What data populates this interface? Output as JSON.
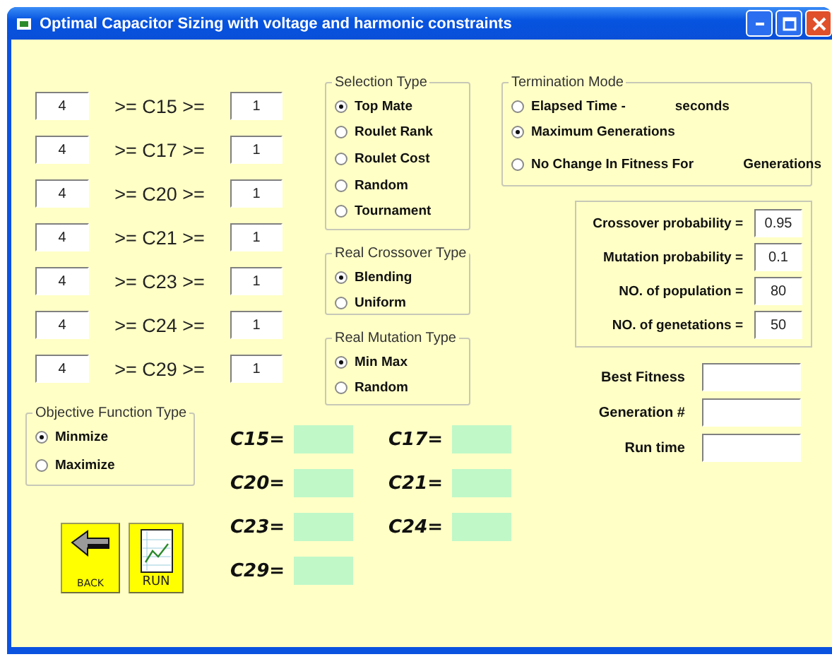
{
  "window": {
    "title": "Optimal Capacitor Sizing with voltage and harmonic constraints"
  },
  "range_rows": [
    {
      "upper": "4",
      "label": ">= C15 >=",
      "lower": "1"
    },
    {
      "upper": "4",
      "label": ">= C17 >=",
      "lower": "1"
    },
    {
      "upper": "4",
      "label": ">= C20 >=",
      "lower": "1"
    },
    {
      "upper": "4",
      "label": ">= C21 >=",
      "lower": "1"
    },
    {
      "upper": "4",
      "label": ">= C23 >=",
      "lower": "1"
    },
    {
      "upper": "4",
      "label": ">= C24 >=",
      "lower": "1"
    },
    {
      "upper": "4",
      "label": ">= C29 >=",
      "lower": "1"
    }
  ],
  "selection_type": {
    "title": "Selection Type",
    "options": [
      {
        "label": "Top Mate",
        "selected": true
      },
      {
        "label": "Roulet Rank",
        "selected": false
      },
      {
        "label": "Roulet Cost",
        "selected": false
      },
      {
        "label": "Random",
        "selected": false
      },
      {
        "label": "Tournament",
        "selected": false
      }
    ]
  },
  "crossover_type": {
    "title": "Real Crossover Type",
    "options": [
      {
        "label": "Blending",
        "selected": true
      },
      {
        "label": "Uniform",
        "selected": false
      }
    ]
  },
  "mutation_type": {
    "title": "Real Mutation Type",
    "options": [
      {
        "label": "Min Max",
        "selected": true
      },
      {
        "label": "Random",
        "selected": false
      }
    ]
  },
  "termination_mode": {
    "title": "Termination Mode",
    "options": [
      {
        "label": "Elapsed Time -",
        "suffix": "seconds",
        "selected": false
      },
      {
        "label": "Maximum Generations",
        "selected": true
      },
      {
        "label": "No Change In Fitness For",
        "suffix": "Generations",
        "selected": false
      }
    ]
  },
  "parameters": [
    {
      "label": "Crossover probability =",
      "value": "0.95"
    },
    {
      "label": "Mutation probability =",
      "value": "0.1"
    },
    {
      "label": "NO. of population =",
      "value": "80"
    },
    {
      "label": "NO. of genetations =",
      "value": "50"
    }
  ],
  "outputs": [
    {
      "label": "Best Fitness"
    },
    {
      "label": "Generation #"
    },
    {
      "label": "Run time"
    }
  ],
  "objective_type": {
    "title": "Objective Function Type",
    "options": [
      {
        "label": "Minmize",
        "selected": true
      },
      {
        "label": "Maximize",
        "selected": false
      }
    ]
  },
  "results": [
    {
      "label": "C15="
    },
    {
      "label": "C17="
    },
    {
      "label": "C20="
    },
    {
      "label": "C21="
    },
    {
      "label": "C23="
    },
    {
      "label": "C24="
    },
    {
      "label": "C29="
    }
  ],
  "buttons": [
    {
      "kind": "back",
      "label": "BACK"
    },
    {
      "kind": "run",
      "label": "RUN"
    }
  ]
}
